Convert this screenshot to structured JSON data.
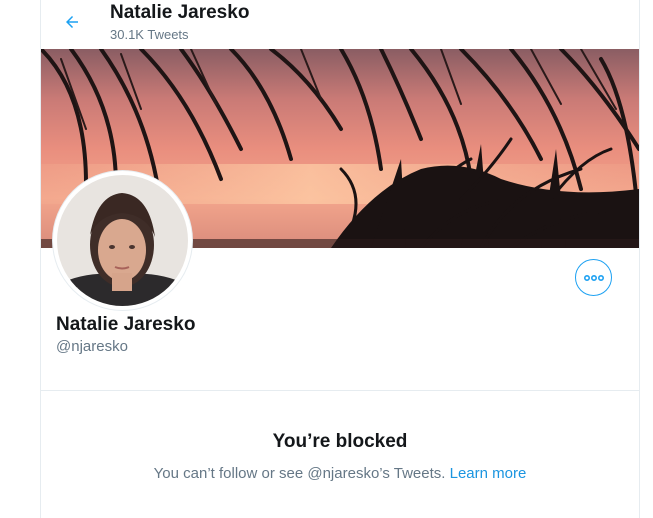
{
  "header": {
    "title": "Natalie Jaresko",
    "tweet_count": "30.1K Tweets"
  },
  "profile": {
    "name": "Natalie Jaresko",
    "handle": "@njaresko"
  },
  "blocked": {
    "title": "You’re blocked",
    "message": "You can’t follow or see @njaresko’s Tweets.",
    "learn_more": "Learn more"
  },
  "icons": {
    "back": "arrow-left-icon",
    "more": "more-horizontal-icon"
  },
  "colors": {
    "accent": "#1da1f2",
    "link": "#1b95e0",
    "secondary_text": "#657786",
    "border": "#e6ecf0"
  }
}
